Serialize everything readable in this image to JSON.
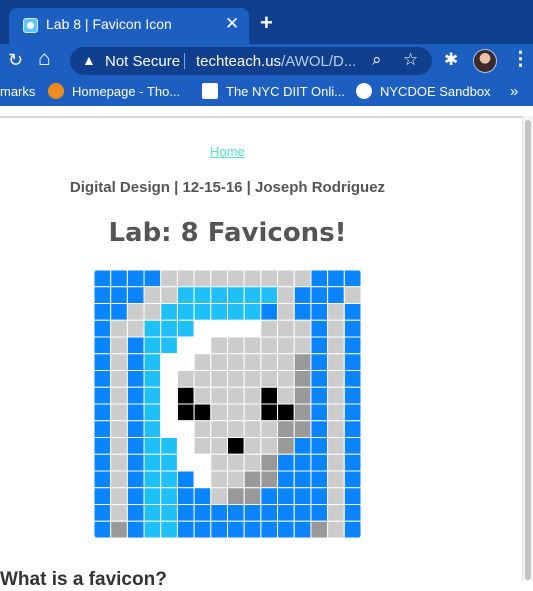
{
  "tab": {
    "title": "Lab 8 | Favicon Icon",
    "close_glyph": "✕",
    "new_tab_glyph": "+"
  },
  "toolbar": {
    "reload_glyph": "↻",
    "home_glyph": "⌂",
    "security_label": "Not Secure",
    "url_host": "techteach.us",
    "url_path": "/AWOL/D...",
    "search_glyph": "⌕",
    "star_glyph": "☆",
    "extensions_glyph": "✱",
    "menu_glyph": "⋮"
  },
  "bookmarks": {
    "items": [
      {
        "label": "marks",
        "icon": "none"
      },
      {
        "label": "Homepage - Tho...",
        "icon": "orange-b-icon"
      },
      {
        "label": "The NYC DIIT Onli...",
        "icon": "nyc-diit-icon"
      },
      {
        "label": "NYCDOE Sandbox",
        "icon": "globe-icon"
      }
    ],
    "more_glyph": "»"
  },
  "page": {
    "home_link": "Home",
    "byline": "Digital Design | 12-15-16 | Joseph Rodriguez",
    "heading": "Lab: 8 Favicons!",
    "cut_text": "What is a favicon?"
  },
  "colors": {
    "tab_strip": "#0f3f8d",
    "toolbar": "#1d5fc0",
    "link": "#53e5c9",
    "text": "#555555"
  },
  "pixel_art": {
    "cols": 16,
    "rows": 16,
    "palette": {
      "B": "#0a84ff",
      "C": "#1ec0f7",
      "W": "#ffffff",
      "G": "#cccccc",
      "D": "#999999",
      "K": "#000000"
    },
    "grid": [
      "BBBBGGGGGGGGGBBB",
      "BBBGGCCCCCCGBBBG",
      "BBGGCCCCCCBGBBGB",
      "BGGCCCWWWWGGGBGB",
      "BGBCCWWGGGGGGBGB",
      "BGBCWWGGGGGGDBGB",
      "BGBCWGGGGGGGDBGB",
      "BGBCWKGGGGKGDBGB",
      "BGBCWKKGGGKKDBGB",
      "BGBCWWGGGGGDDBGB",
      "BGBCCWGGKGGDBBGB",
      "BGBCCWWGGGDBBBGB",
      "BGBCCBWGGDDBBBGB",
      "BGBCCBBGDDBBBBGB",
      "BGBCCBBBBBBBBBGB",
      "BDBCCBBBBBBBBDGB"
    ]
  }
}
